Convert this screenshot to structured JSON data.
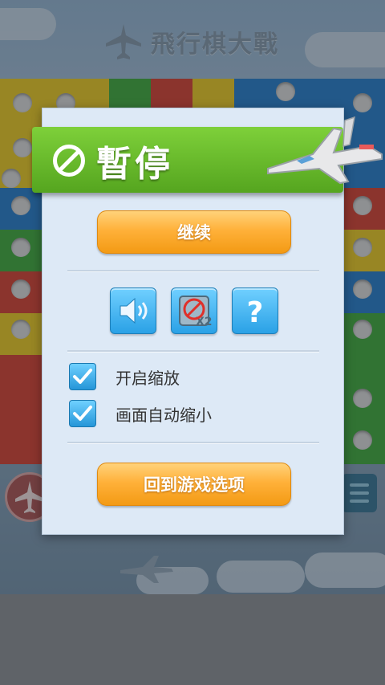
{
  "background": {
    "title": "飛行棋大戰"
  },
  "dialog": {
    "title": "暫停",
    "continue_label": "继续",
    "back_label": "回到游戏选项",
    "icons": [
      "speaker-icon",
      "no-zoom-icon",
      "help-icon"
    ],
    "help_glyph": "?",
    "options": [
      {
        "label": "开启缩放",
        "checked": true
      },
      {
        "label": "画面自动缩小",
        "checked": true
      }
    ]
  },
  "colors": {
    "banner_green": "#6cc02e",
    "button_orange": "#ffb13a",
    "icon_blue": "#2aa1e6",
    "dialog_bg": "#dde9f6"
  }
}
